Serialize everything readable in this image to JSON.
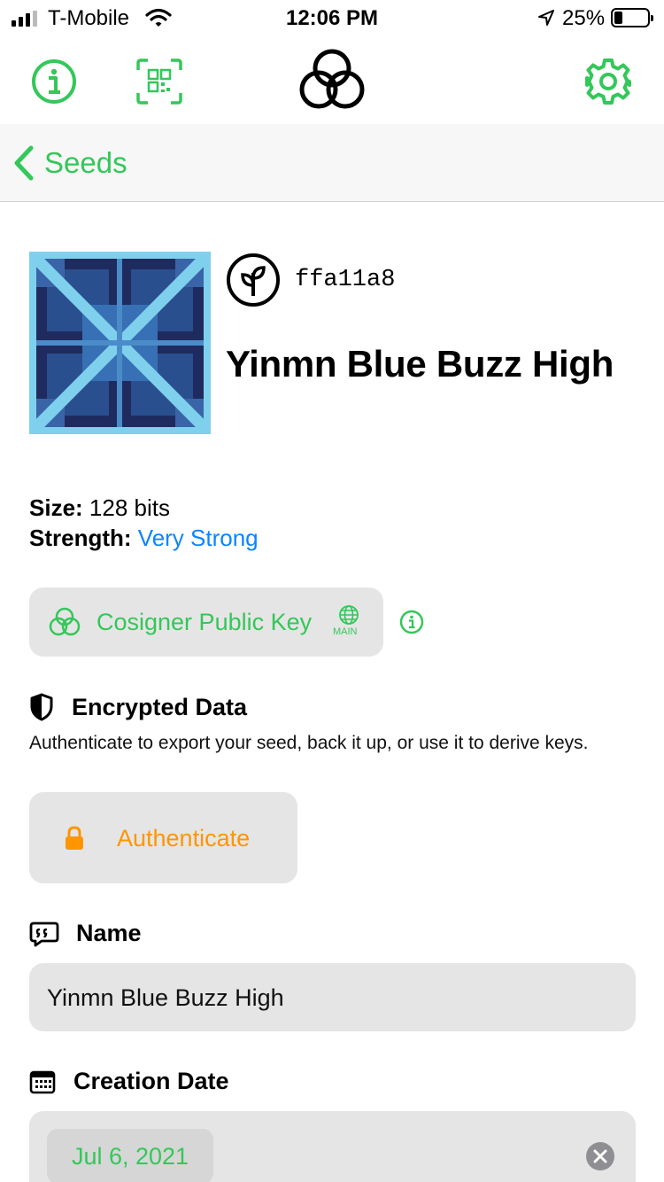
{
  "status_bar": {
    "carrier": "T-Mobile",
    "time": "12:06 PM",
    "battery": "25%"
  },
  "toolbar": {
    "icons": [
      "info-icon",
      "qr-code-icon",
      "app-logo-icon",
      "gear-icon"
    ]
  },
  "nav": {
    "back_label": "Seeds"
  },
  "seed": {
    "fingerprint": "ffa11a8",
    "title": "Yinmn Blue Buzz High",
    "size_label": "Size:",
    "size_value": "128 bits",
    "strength_label": "Strength:",
    "strength_value": "Very Strong"
  },
  "cosigner": {
    "label": "Cosigner Public Key",
    "network": "MAIN"
  },
  "encrypted": {
    "heading": "Encrypted Data",
    "description": "Authenticate to export your seed, back it up, or use it to derive keys.",
    "button_label": "Authenticate"
  },
  "name_section": {
    "heading": "Name",
    "value": "Yinmn Blue Buzz High"
  },
  "creation_date": {
    "heading": "Creation Date",
    "value": "Jul 6, 2021"
  },
  "colors": {
    "accent_green": "#34c759",
    "link_blue": "#0a84ff",
    "warning_orange": "#ff9500",
    "field_bg": "#e5e5e5"
  }
}
